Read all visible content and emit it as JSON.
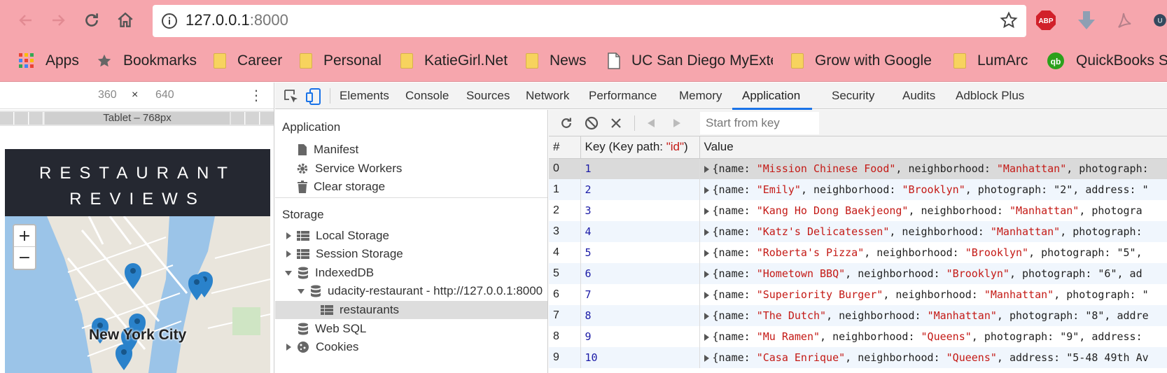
{
  "browser": {
    "url_host": "127.0.0.1",
    "url_port": ":8000",
    "extensions": [
      "ABP",
      "download-icon",
      "pdf-icon",
      "U"
    ]
  },
  "bookmarks": [
    {
      "label": "Apps",
      "icon": "apps-grid-icon"
    },
    {
      "label": "Bookmarks",
      "icon": "star-icon"
    },
    {
      "label": "Career",
      "icon": "folder-icon"
    },
    {
      "label": "Personal",
      "icon": "folder-icon"
    },
    {
      "label": "KatieGirl.Net",
      "icon": "folder-icon"
    },
    {
      "label": "News",
      "icon": "folder-icon"
    },
    {
      "label": "UC San Diego MyExte",
      "icon": "page-icon"
    },
    {
      "label": "Grow with Google",
      "icon": "folder-icon"
    },
    {
      "label": "LumArc",
      "icon": "folder-icon"
    },
    {
      "label": "QuickBooks Se",
      "icon": "qb-icon"
    }
  ],
  "device": {
    "width": "360",
    "times": "×",
    "height": "640",
    "media_query": "Tablet – 768px",
    "site_title_1": "RESTAURANT",
    "site_title_2": "REVIEWS",
    "zoom_in": "+",
    "zoom_out": "−",
    "city_label": "New York City"
  },
  "devtools": {
    "tabs": [
      "Elements",
      "Console",
      "Sources",
      "Network",
      "Performance",
      "Memory",
      "Application",
      "Security",
      "Audits",
      "Adblock Plus"
    ],
    "active_tab": "Application",
    "sidebar": {
      "application_heading": "Application",
      "manifest": "Manifest",
      "service_workers": "Service Workers",
      "clear_storage": "Clear storage",
      "storage_heading": "Storage",
      "local_storage": "Local Storage",
      "session_storage": "Session Storage",
      "indexeddb": "IndexedDB",
      "db_name": "udacity-restaurant - http://127.0.0.1:8000",
      "store_name": "restaurants",
      "web_sql": "Web SQL",
      "cookies": "Cookies"
    },
    "idb": {
      "key_placeholder": "Start from key",
      "col_index": "#",
      "col_key_prefix": "Key (Key path: ",
      "col_key_path": "\"id\"",
      "col_key_suffix": ")",
      "col_value": "Value",
      "rows": [
        {
          "idx": "0",
          "key": "1",
          "name": "\"Mission Chinese Food\"",
          "hood": "\"Manhattan\"",
          "tail": ", photograph:"
        },
        {
          "idx": "1",
          "key": "2",
          "name": "\"Emily\"",
          "hood": "\"Brooklyn\"",
          "tail": ", photograph: \"2\", address: \""
        },
        {
          "idx": "2",
          "key": "3",
          "name": "\"Kang Ho Dong Baekjeong\"",
          "hood": "\"Manhattan\"",
          "tail": ", photogra"
        },
        {
          "idx": "3",
          "key": "4",
          "name": "\"Katz's Delicatessen\"",
          "hood": "\"Manhattan\"",
          "tail": ", photograph:"
        },
        {
          "idx": "4",
          "key": "5",
          "name": "\"Roberta's Pizza\"",
          "hood": "\"Brooklyn\"",
          "tail": ", photograph: \"5\","
        },
        {
          "idx": "5",
          "key": "6",
          "name": "\"Hometown BBQ\"",
          "hood": "\"Brooklyn\"",
          "tail": ", photograph: \"6\", ad"
        },
        {
          "idx": "6",
          "key": "7",
          "name": "\"Superiority Burger\"",
          "hood": "\"Manhattan\"",
          "tail": ", photograph: \""
        },
        {
          "idx": "7",
          "key": "8",
          "name": "\"The Dutch\"",
          "hood": "\"Manhattan\"",
          "tail": ", photograph: \"8\", addre"
        },
        {
          "idx": "8",
          "key": "9",
          "name": "\"Mu Ramen\"",
          "hood": "\"Queens\"",
          "tail": ", photograph: \"9\", address:"
        },
        {
          "idx": "9",
          "key": "10",
          "name": "\"Casa Enrique\"",
          "hood": "\"Queens\"",
          "tail": ", address: \"5-48 49th Av"
        }
      ]
    }
  },
  "colors": {
    "chrome_pink": "#f6a6ad",
    "header_dark": "#252831",
    "active_tab_underline": "#1a73e8",
    "string_red": "#c41a16",
    "key_blue": "#1a1aa6"
  }
}
